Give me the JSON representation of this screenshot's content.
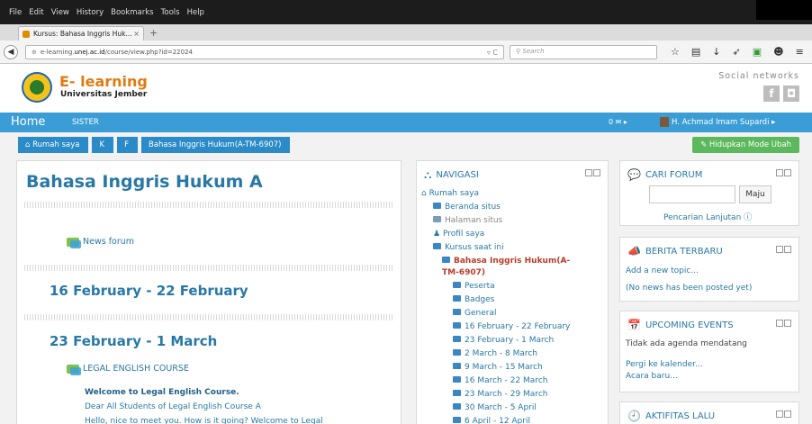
{
  "browser": {
    "menu": [
      "File",
      "Edit",
      "View",
      "History",
      "Bookmarks",
      "Tools",
      "Help"
    ],
    "tab_title": "Kursus: Bahasa Inggris Huk...",
    "tab_close": "×",
    "new_tab": "+",
    "url_prefix": "e-learning.",
    "url_domain": "unej.ac.id",
    "url_path": "/course/view.php?id=22024",
    "search_placeholder": "Search"
  },
  "site": {
    "brand_title": "E- learning",
    "brand_subtitle": "Universitas Jember",
    "social_label": "Social networks",
    "facebook_glyph": "f",
    "other_glyph": "◘"
  },
  "topnav": {
    "home": "Home",
    "sister": "SISTER",
    "messages": "0 ✉ ▸",
    "user": "H. Achmad Imam Supardi ▸"
  },
  "breadcrumb": [
    "Rumah saya",
    "K",
    "F",
    "Bahasa Inggris Hukum(A-TM-6907)"
  ],
  "edit_button": "Hidupkan Mode Ubah",
  "course": {
    "title": "Bahasa Inggris Hukum A",
    "news_forum": "News forum",
    "week1": "16 February - 22 February",
    "week2": "23 February - 1 March",
    "legal_english": "LEGAL ENGLISH COURSE",
    "welcome": "Welcome to Legal English Course.",
    "dear": "Dear All Students of Legal English Course A",
    "hello": "Hello, nice to meet you. How is it going? Welcome to Legal"
  },
  "navigation": {
    "header": "NAVIGASI",
    "items": [
      "Rumah saya",
      "Beranda situs",
      "Halaman situs",
      "Profil saya",
      "Kursus saat ini",
      "Bahasa Inggris Hukum(A-",
      "TM-6907)",
      "Peserta",
      "Badges",
      "General",
      "16 February - 22 February",
      "23 February - 1 March",
      "2 March - 8 March",
      "9 March - 15 March",
      "16 March - 22 March",
      "23 March - 29 March",
      "30 March - 5 April",
      "6 April - 12 April"
    ]
  },
  "forum_search": {
    "header": "CARI FORUM",
    "button": "Maju",
    "advanced": "Pencarian Lanjutan ⓘ"
  },
  "news": {
    "header": "BERITA TERBARU",
    "add": "Add a new topic...",
    "empty": "(No news has been posted yet)"
  },
  "events": {
    "header": "UPCOMING EVENTS",
    "empty": "Tidak ada agenda mendatang",
    "calendar": "Pergi ke kalender...",
    "new_event": "Acara baru..."
  },
  "recent": {
    "header": "AKTIFITAS LALU"
  }
}
